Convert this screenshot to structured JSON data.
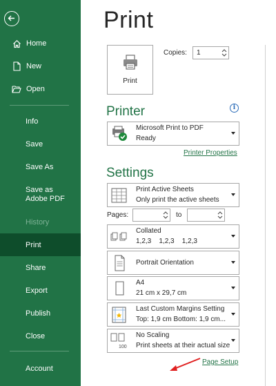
{
  "sidebar": {
    "items": [
      {
        "label": "Home"
      },
      {
        "label": "New"
      },
      {
        "label": "Open"
      },
      {
        "label": "Info"
      },
      {
        "label": "Save"
      },
      {
        "label": "Save As"
      },
      {
        "label": "Save as Adobe PDF"
      },
      {
        "label": "History"
      },
      {
        "label": "Print"
      },
      {
        "label": "Share"
      },
      {
        "label": "Export"
      },
      {
        "label": "Publish"
      },
      {
        "label": "Close"
      },
      {
        "label": "Account"
      }
    ]
  },
  "main": {
    "title": "Print",
    "print_button_label": "Print",
    "copies_label": "Copies:",
    "copies_value": "1",
    "printer_heading": "Printer",
    "printer": {
      "name": "Microsoft Print to PDF",
      "status": "Ready"
    },
    "printer_properties_link": "Printer Properties",
    "settings_heading": "Settings",
    "settings": [
      {
        "line1": "Print Active Sheets",
        "line2": "Only print the active sheets"
      },
      {
        "line1": "Collated",
        "line2": "1,2,3    1,2,3    1,2,3"
      },
      {
        "line1": "Portrait Orientation",
        "line2": ""
      },
      {
        "line1": "A4",
        "line2": "21 cm x 29,7 cm"
      },
      {
        "line1": "Last Custom Margins Setting",
        "line2": "Top: 1,9 cm Bottom: 1,9 cm..."
      },
      {
        "line1": "No Scaling",
        "line2": "Print sheets at their actual size"
      }
    ],
    "pages_label": "Pages:",
    "to_label": "to",
    "page_setup_link": "Page Setup"
  },
  "colors": {
    "brand": "#217346",
    "active_nav": "#0e4d2b",
    "annotation_arrow": "#e02020"
  }
}
